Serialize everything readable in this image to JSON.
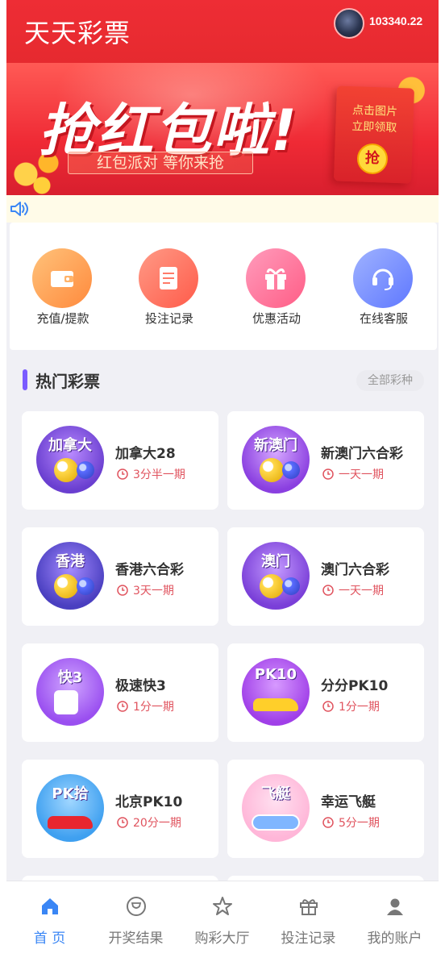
{
  "header": {
    "app_title": "天天彩票",
    "balance": "103340.22"
  },
  "banner": {
    "headline": "抢红包啦!",
    "tagline": "红包派对 等你来抢",
    "envelope_text_1": "点击图片",
    "envelope_text_2": "立即领取",
    "envelope_button": "抢"
  },
  "quick_actions": [
    {
      "label": "充值/提款",
      "icon": "wallet-icon",
      "color_from": "#ffb36a",
      "color_to": "#ff8a3d"
    },
    {
      "label": "投注记录",
      "icon": "document-icon",
      "color_from": "#ff8f7a",
      "color_to": "#ff5b4a"
    },
    {
      "label": "优惠活动",
      "icon": "gift-icon",
      "color_from": "#ff8fb0",
      "color_to": "#ff5d86"
    },
    {
      "label": "在线客服",
      "icon": "headset-icon",
      "color_from": "#8fa6ff",
      "color_to": "#5f78ff"
    }
  ],
  "section": {
    "title": "热门彩票",
    "all_types": "全部彩种"
  },
  "lotteries": [
    {
      "name": "加拿大28",
      "period": "3分半一期",
      "thumb_text": "加拿大",
      "thumb_bg": "#6a3fd0"
    },
    {
      "name": "新澳门六合彩",
      "period": "一天一期",
      "thumb_text": "新澳门",
      "thumb_bg": "#8a3fe0"
    },
    {
      "name": "香港六合彩",
      "period": "3天一期",
      "thumb_text": "香港",
      "thumb_bg": "#4a3fc0"
    },
    {
      "name": "澳门六合彩",
      "period": "一天一期",
      "thumb_text": "澳门",
      "thumb_bg": "#7a3fd8"
    },
    {
      "name": "极速快3",
      "period": "1分一期",
      "thumb_text": "快3",
      "thumb_bg": "#9a4ff0"
    },
    {
      "name": "分分PK10",
      "period": "1分一期",
      "thumb_text": "PK10",
      "thumb_bg": "#a03fe8"
    },
    {
      "name": "北京PK10",
      "period": "20分一期",
      "thumb_text": "PK拾",
      "thumb_bg": "#3fa0f0"
    },
    {
      "name": "幸运飞艇",
      "period": "5分一期",
      "thumb_text": "飞艇",
      "thumb_bg": "#ffb6d8"
    }
  ],
  "bottom_nav": [
    {
      "label": "首 页",
      "icon": "home-icon",
      "active": true
    },
    {
      "label": "开奖结果",
      "icon": "trophy-icon",
      "active": false
    },
    {
      "label": "购彩大厅",
      "icon": "star-icon",
      "active": false
    },
    {
      "label": "投注记录",
      "icon": "gift-icon",
      "active": false
    },
    {
      "label": "我的账户",
      "icon": "user-icon",
      "active": false
    }
  ],
  "colors": {
    "header_red": "#ee2d35",
    "accent_purple": "#7a5cff",
    "period_red": "#e0535e",
    "nav_active": "#3a86f5"
  }
}
